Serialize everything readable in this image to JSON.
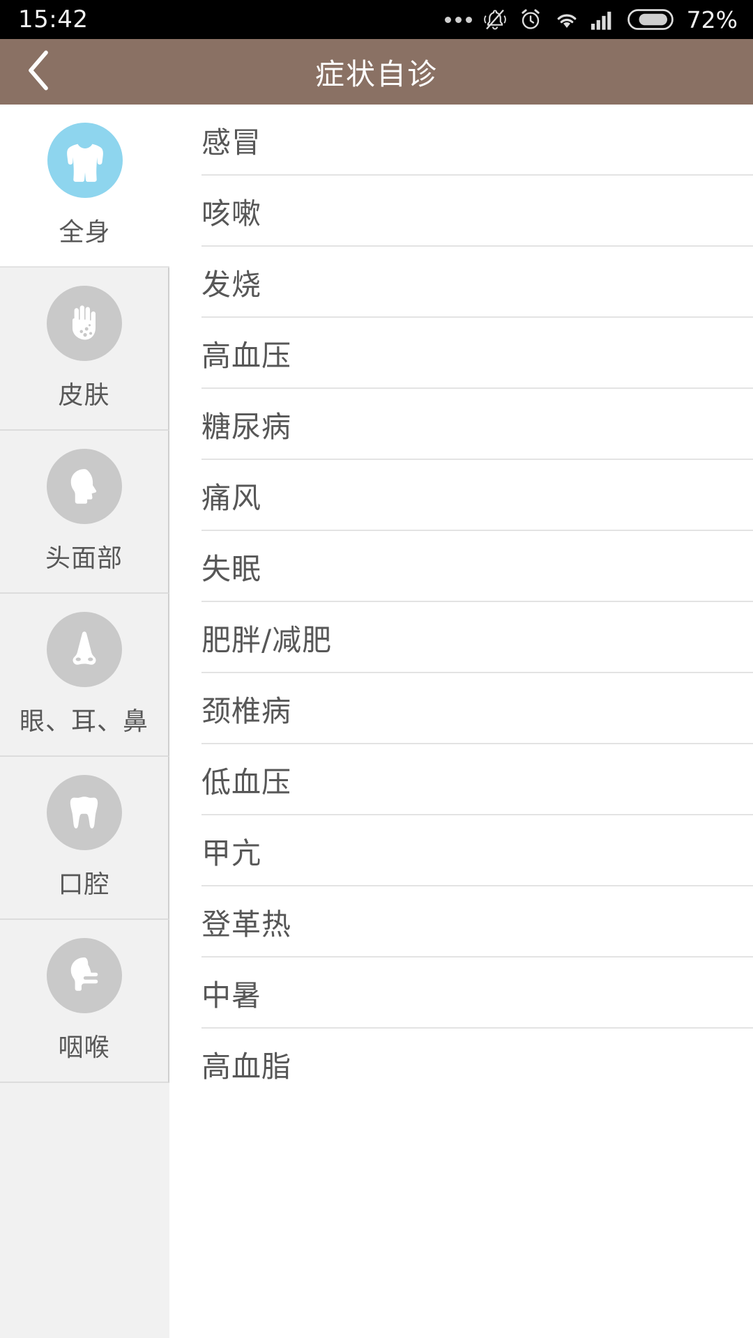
{
  "status_bar": {
    "time": "15:42",
    "battery_percent": "72%",
    "battery_level": 72,
    "icons": [
      "more-dots-icon",
      "bell-muted-icon",
      "alarm-clock-icon",
      "wifi-icon",
      "signal-bars-icon",
      "battery-icon"
    ]
  },
  "header": {
    "title": "症状自诊",
    "back_icon": "chevron-left-icon",
    "background_color": "#8a7164",
    "title_color": "#fdfdfd"
  },
  "sidebar": {
    "active_index": 0,
    "active_color": "#8ed5ee",
    "inactive_color": "#c9c9c9",
    "items": [
      {
        "label": "全身",
        "icon": "torso-body-icon",
        "active": true
      },
      {
        "label": "皮肤",
        "icon": "hand-rash-icon",
        "active": false
      },
      {
        "label": "头面部",
        "icon": "head-profile-icon",
        "active": false
      },
      {
        "label": "眼、耳、鼻",
        "icon": "nose-icon",
        "active": false
      },
      {
        "label": "口腔",
        "icon": "tooth-icon",
        "active": false
      },
      {
        "label": "咽喉",
        "icon": "throat-head-icon",
        "active": false
      }
    ]
  },
  "symptom_list": {
    "items": [
      {
        "label": "感冒"
      },
      {
        "label": "咳嗽"
      },
      {
        "label": "发烧"
      },
      {
        "label": "高血压"
      },
      {
        "label": "糖尿病"
      },
      {
        "label": "痛风"
      },
      {
        "label": "失眠"
      },
      {
        "label": "肥胖/减肥"
      },
      {
        "label": "颈椎病"
      },
      {
        "label": "低血压"
      },
      {
        "label": "甲亢"
      },
      {
        "label": "登革热"
      },
      {
        "label": "中暑"
      },
      {
        "label": "高血脂"
      }
    ]
  }
}
